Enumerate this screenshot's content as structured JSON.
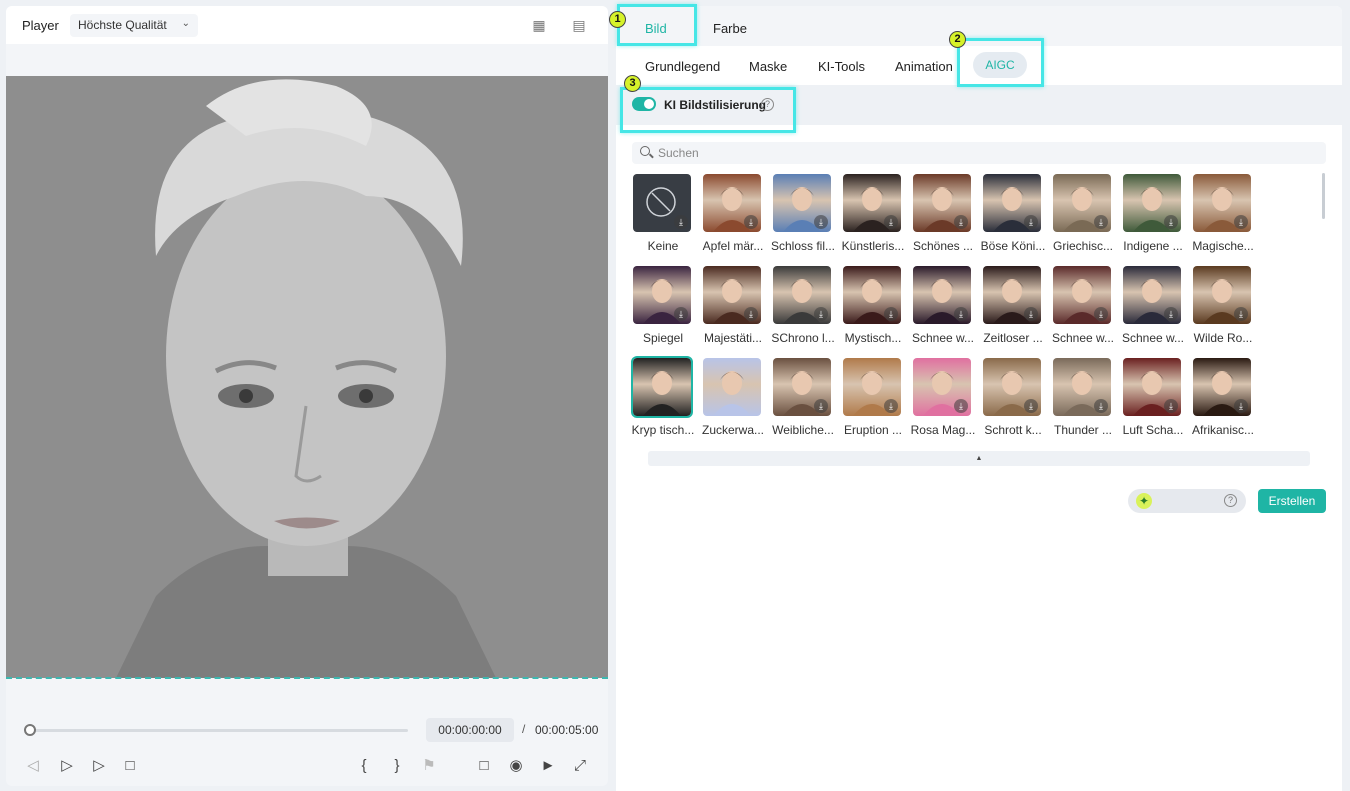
{
  "player": {
    "label": "Player",
    "quality": "Höchste Qualität",
    "time_current": "00:00:00:00",
    "time_separator": "/",
    "time_total": "00:00:05:00",
    "progress": 0.0,
    "controls": [
      "prev-frame-icon",
      "play-frame-icon",
      "play-icon",
      "stop-icon",
      "mark-in-icon",
      "mark-out-icon",
      "marker-icon",
      "monitor-icon",
      "camera-icon",
      "volume-icon",
      "fullscreen-icon"
    ],
    "mark_in": "{",
    "mark_out": "}"
  },
  "tabs_main": [
    {
      "label": "Bild",
      "active": true
    },
    {
      "label": "Farbe",
      "active": false
    }
  ],
  "tabs_sub": [
    {
      "label": "Grundlegend"
    },
    {
      "label": "Maske"
    },
    {
      "label": "KI-Tools"
    },
    {
      "label": "Animation"
    },
    {
      "label": "AIGC",
      "active": true
    }
  ],
  "feature": {
    "label": "KI Bildstilisierung",
    "enabled": true,
    "help": "?"
  },
  "search": {
    "placeholder": "Suchen",
    "value": ""
  },
  "styles": [
    [
      "Keine",
      "Apfel mär...",
      "Schloss fil...",
      "Künstleris...",
      "Schönes ...",
      "Böse Köni...",
      "Griechisc...",
      "Indigene ...",
      "Magische..."
    ],
    [
      "Spiegel",
      "Majestäti...",
      "SChrono l...",
      "Mystisch...",
      "Schnee w...",
      "Zeitloser ...",
      "Schnee w...",
      "Schnee w...",
      "Wilde Ro..."
    ],
    [
      "Kryp tisch...",
      "Zuckerwa...",
      "Weibliche...",
      "Eruption ...",
      "Rosa Mag...",
      "Schrott k...",
      "Thunder ...",
      "Luft Scha...",
      "Afrikanisc..."
    ]
  ],
  "thumb_colors": [
    [
      "#3a3f45",
      "#8b4a2f",
      "#5a7fb5",
      "#2b2220",
      "#6b3a28",
      "#2a2e3a",
      "#7a6a55",
      "#3f5a3a",
      "#8a5a3a"
    ],
    [
      "#3a2440",
      "#4a2a20",
      "#3a3a3a",
      "#3a1a1a",
      "#2a1a2a",
      "#2a1a1a",
      "#5a2a2a",
      "#2a2a3a",
      "#5a3a20"
    ],
    [
      "#222222",
      "#b8c4e8",
      "#6a5040",
      "#b07a4a",
      "#e070a0",
      "#8a6a4a",
      "#7a6a5a",
      "#6a2020",
      "#2a1a12"
    ]
  ],
  "actions": {
    "create_label": "Erstellen",
    "help": "?"
  },
  "annotations": [
    {
      "label": "1"
    },
    {
      "label": "2"
    },
    {
      "label": "3"
    }
  ],
  "colors": {
    "accent": "#1fb5a5",
    "highlight": "#46e6e6",
    "badge": "#d6f22a"
  }
}
